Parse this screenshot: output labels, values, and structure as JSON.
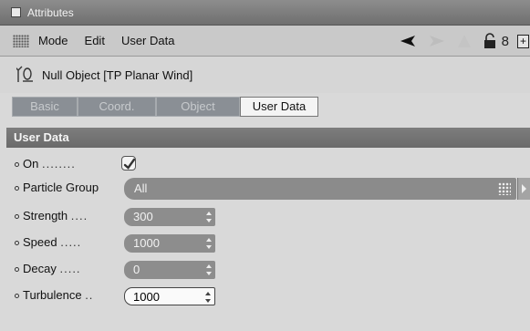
{
  "window": {
    "title": "Attributes"
  },
  "menu": {
    "items": [
      "Mode",
      "Edit",
      "User Data"
    ],
    "icons": [
      "back-arrow-icon",
      "forward-arrow-icon",
      "up-arrow-icon",
      "lock-icon",
      "new-window-icon"
    ],
    "history_count": "8",
    "new_window_symbol": "+"
  },
  "object": {
    "name": "Null Object [TP Planar Wind]",
    "icon": "null-object-icon"
  },
  "tabs": [
    {
      "label": "Basic",
      "active": false
    },
    {
      "label": "Coord.",
      "active": false
    },
    {
      "label": "Object",
      "active": false
    },
    {
      "label": "User Data",
      "active": true
    }
  ],
  "section": {
    "title": "User Data"
  },
  "params": {
    "on": {
      "label": "On",
      "dots": "........",
      "checked": true
    },
    "particle_group": {
      "label": "Particle Group",
      "value": "All"
    },
    "strength": {
      "label": "Strength",
      "dots": "....",
      "value": "300"
    },
    "speed": {
      "label": "Speed",
      "dots": ".....",
      "value": "1000"
    },
    "decay": {
      "label": "Decay",
      "dots": ".....",
      "value": "0"
    },
    "turbulence": {
      "label": "Turbulence",
      "dots": "..",
      "value": "1000"
    }
  },
  "colors": {
    "background": "#d9d9d9",
    "title_bar": "#7d7d7d",
    "field": "#8d8d8d",
    "tab_inactive": "#8a8f95",
    "tab_active": "#f4f4f4"
  }
}
